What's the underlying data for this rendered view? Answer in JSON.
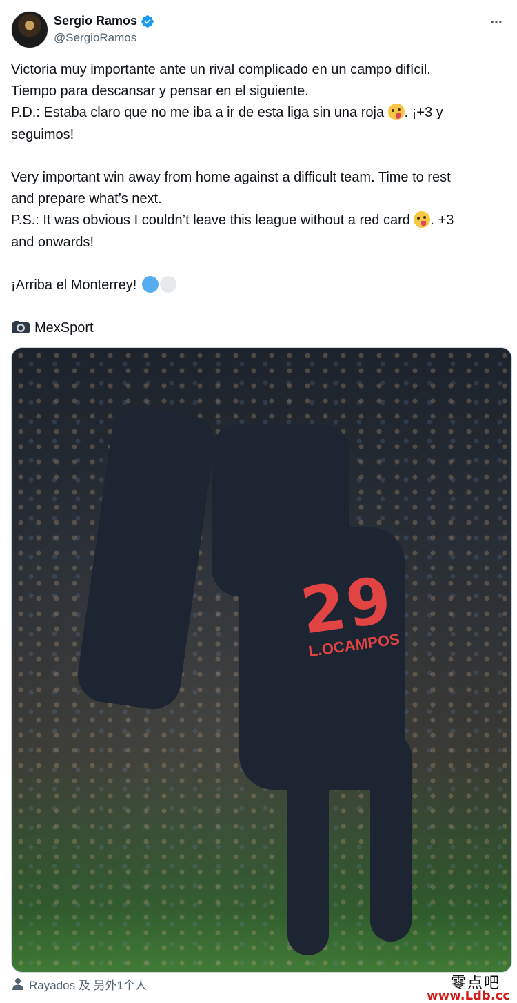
{
  "author": {
    "display_name": "Sergio Ramos",
    "handle": "@SergioRamos",
    "verified": true
  },
  "tweet": {
    "es_line1": "Victoria muy importante ante un rival complicado en un campo difícil.",
    "es_line2": "Tiempo para descansar y pensar en el siguiente.",
    "es_line3_before": "P.D.: Estaba claro que no me iba a ir de esta liga sin una roja ",
    "es_line3_after": ".  ¡+3 y",
    "es_line4": "seguimos!",
    "en_line1": "Very important win away from home against a difficult team. Time to rest",
    "en_line2": "and prepare what’s next.",
    "en_line3_before": "P.S.: It was obvious I couldn’t leave this league without a red card ",
    "en_line3_after": ". +3",
    "en_line4": "and onwards!",
    "closing": "¡Arriba el Monterrey! ",
    "photo_credit": "MexSport"
  },
  "media": {
    "jersey_number": "29",
    "jersey_name": "L.OCAMPOS"
  },
  "footer": {
    "tagged": "Rayados 及 另外1个人"
  },
  "watermark": {
    "cn": "零点吧",
    "url": "www.Ldb.cc"
  },
  "colors": {
    "verified_badge": "#1d9bf0",
    "secondary_text": "#536471",
    "monterrey_blue": "#55acee",
    "watermark_red": "#d21c1c"
  },
  "icons": [
    "verified-badge-icon",
    "more-icon",
    "emoji-tongue-icon",
    "blue-circle-icon",
    "white-circle-icon",
    "camera-icon",
    "person-icon"
  ]
}
